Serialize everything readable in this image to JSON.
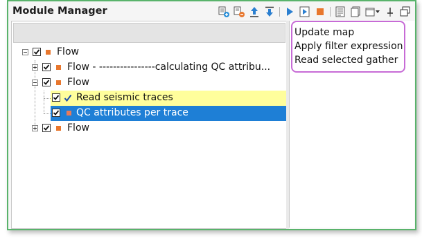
{
  "window": {
    "title": "Module Manager"
  },
  "toolbar": {
    "buttons": [
      "add-module-icon",
      "remove-module-icon",
      "move-up-icon",
      "move-down-icon",
      "run-icon",
      "run-step-icon",
      "stop-icon",
      "properties-icon",
      "copy-icon",
      "window-menu-icon",
      "pin-icon",
      "float-icon"
    ]
  },
  "filter": {
    "value": ""
  },
  "tree": {
    "rows": [
      {
        "label": "Flow",
        "checked": true,
        "expander": "minus"
      },
      {
        "label": "Flow - ----------------calculating QC attribu...",
        "checked": true,
        "expander": "plus"
      },
      {
        "label": "Flow",
        "checked": true,
        "expander": "minus"
      },
      {
        "label": "Read seismic traces",
        "checked": true,
        "status": "done"
      },
      {
        "label": "QC attributes per trace",
        "checked": true,
        "status": "selected"
      },
      {
        "label": "Flow",
        "checked": true,
        "expander": "plus"
      }
    ]
  },
  "popup": {
    "items": [
      "Update map",
      "Apply filter expression",
      "Read selected gather"
    ]
  },
  "colors": {
    "frame_border": "#59b36b",
    "popup_border": "#c76bd6",
    "module_square": "#e8772e",
    "selection_blue": "#1e7fd6",
    "highlight_yellow": "#fffe9c"
  }
}
